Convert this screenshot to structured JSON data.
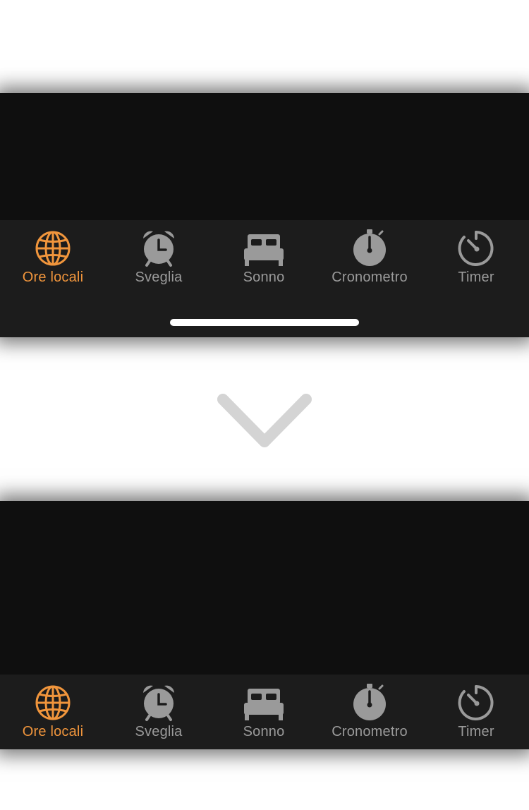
{
  "colors": {
    "active": "#f0953c",
    "inactive": "#9a9a9a",
    "tabbar_bg": "#1c1c1c",
    "panel_bg": "#0f0f0f",
    "arrow": "#d4d4d4"
  },
  "top_panel": {
    "tabs": [
      {
        "label": "Ore locali",
        "icon": "globe-icon",
        "active": true
      },
      {
        "label": "Sveglia",
        "icon": "alarm-clock-icon",
        "active": false
      },
      {
        "label": "Sonno",
        "icon": "bed-icon",
        "active": false
      },
      {
        "label": "Cronometro",
        "icon": "stopwatch-icon",
        "active": false
      },
      {
        "label": "Timer",
        "icon": "timer-icon",
        "active": false
      }
    ]
  },
  "transition_arrow": "chevron-down-icon",
  "bottom_panel": {
    "tabs": [
      {
        "label": "Ore locali",
        "icon": "globe-icon",
        "active": true
      },
      {
        "label": "Sveglia",
        "icon": "alarm-clock-icon",
        "active": false
      },
      {
        "label": "Sonno",
        "icon": "bed-icon",
        "active": false
      },
      {
        "label": "Cronometro",
        "icon": "stopwatch-icon",
        "active": false
      },
      {
        "label": "Timer",
        "icon": "timer-icon",
        "active": false
      }
    ]
  }
}
